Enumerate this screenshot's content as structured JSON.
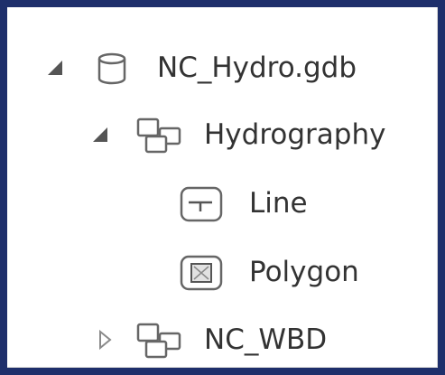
{
  "tree": {
    "items": [
      {
        "label": "NC_Hydro.gdb",
        "icon": "geodatabase-icon",
        "state": "expanded"
      },
      {
        "label": "Hydrography",
        "icon": "feature-dataset-icon",
        "state": "expanded"
      },
      {
        "label": "Line",
        "icon": "line-feature-class-icon",
        "state": "leaf"
      },
      {
        "label": "Polygon",
        "icon": "polygon-feature-class-icon",
        "state": "leaf"
      },
      {
        "label": "NC_WBD",
        "icon": "feature-dataset-icon",
        "state": "collapsed"
      }
    ]
  },
  "colors": {
    "border": "#1e2f6b",
    "text": "#333333",
    "icon": "#666666",
    "expanded_arrow": "#555555",
    "collapsed_arrow": "#8a8a8a"
  }
}
